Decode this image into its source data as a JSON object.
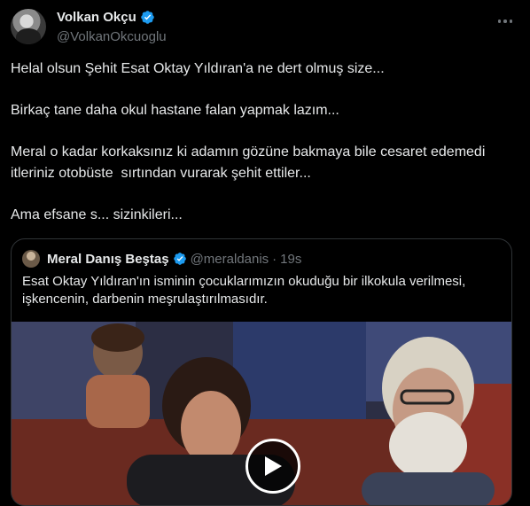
{
  "author": {
    "display_name": "Volkan Okçu",
    "handle": "@VolkanOkcuoglu"
  },
  "tweet": {
    "paragraphs": [
      "Helal olsun Şehit Esat Oktay Yıldıran'a ne dert olmuş size...",
      "Birkaç tane daha okul hastane falan yapmak lazım...",
      "Meral o kadar korkaksınız ki adamın gözüne bakmaya bile cesaret edemedi itleriniz otobüste  sırtından vurarak şehit ettiler...",
      "Ama efsane s... sizinkileri..."
    ]
  },
  "quote": {
    "display_name": "Meral Danış Beştaş",
    "handle": "@meraldanis",
    "separator": "·",
    "time": "19s",
    "text": "Esat Oktay Yıldıran'ın isminin çocuklarımızın okuduğu bir ilkokula verilmesi, işkencenin, darbenin meşrulaştırılmasıdır."
  },
  "icons": {
    "verified": "verified-badge-icon",
    "more": "more-options-icon",
    "play": "play-icon"
  },
  "colors": {
    "background": "#000000",
    "text": "#e7e9ea",
    "muted": "#71767b",
    "verified_blue": "#1d9bf0",
    "border": "#2f3336"
  }
}
